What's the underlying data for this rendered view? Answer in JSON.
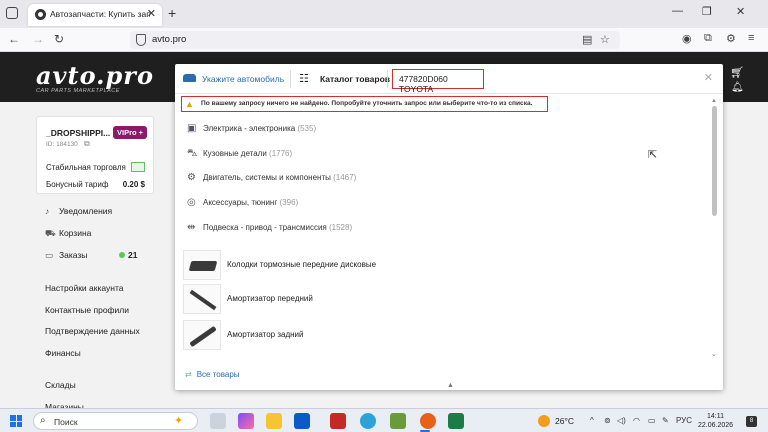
{
  "browser": {
    "tab_title": "Автозапчасти: Купить запчасти",
    "url": "avto.pro"
  },
  "site": {
    "logo": "avto.pro",
    "logo_tagline": "CAR PARTS MARKETPLACE"
  },
  "sidebar": {
    "username": "_DROPSHIPPI...",
    "vip_badge": "VIPro +",
    "user_id": "ID: 184130",
    "stable_trade_label": "Стабильная торговля",
    "bonus_label": "Бонусный тариф",
    "bonus_value": "0.20 $",
    "menu": [
      {
        "label": "Уведомления",
        "icon": "bell-icon"
      },
      {
        "label": "Корзина",
        "icon": "cart-icon"
      },
      {
        "label": "Заказы",
        "icon": "orders-icon",
        "count": "21"
      }
    ],
    "links": [
      "Настройки аккаунта",
      "Контактные профили",
      "Подтверждение данных",
      "Финансы",
      "Склады",
      "Магазины"
    ]
  },
  "search": {
    "car_select_label": "Укажите автомобиль",
    "catalog_label": "Каталог товаров",
    "query": "477820D060 TOYOTA",
    "not_found_message": "По вашему запросу ничего не найдено. Попробуйте уточнить запрос или выберите что-то из списка.",
    "categories": [
      {
        "name": "Электрика - электроника",
        "count": "(535)",
        "icon": "electric-icon"
      },
      {
        "name": "Кузовные детали",
        "count": "(1776)",
        "icon": "body-icon"
      },
      {
        "name": "Двигатель, системы и компоненты",
        "count": "(1467)",
        "icon": "engine-icon"
      },
      {
        "name": "Аксессуары, тюнинг",
        "count": "(396)",
        "icon": "accessory-icon"
      },
      {
        "name": "Подвеска - привод - трансмиссия",
        "count": "(1528)",
        "icon": "suspension-icon"
      }
    ],
    "products": [
      {
        "name": "Колодки тормозные передние дисковые"
      },
      {
        "name": "Амортизатор передний"
      },
      {
        "name": "Амортизатор задний"
      }
    ],
    "all_goods_label": "Все товары"
  },
  "taskbar": {
    "search_placeholder": "Поиск",
    "temperature": "26°C",
    "language": "РУС",
    "time": "14:11",
    "date": "22.06.2026",
    "notifications": "8"
  },
  "colors": {
    "accent": "#2b6cb0",
    "highlight_border": "#d32f2f",
    "header_bg": "#1f1f1f",
    "vip_badge": "#8a1a6b"
  }
}
